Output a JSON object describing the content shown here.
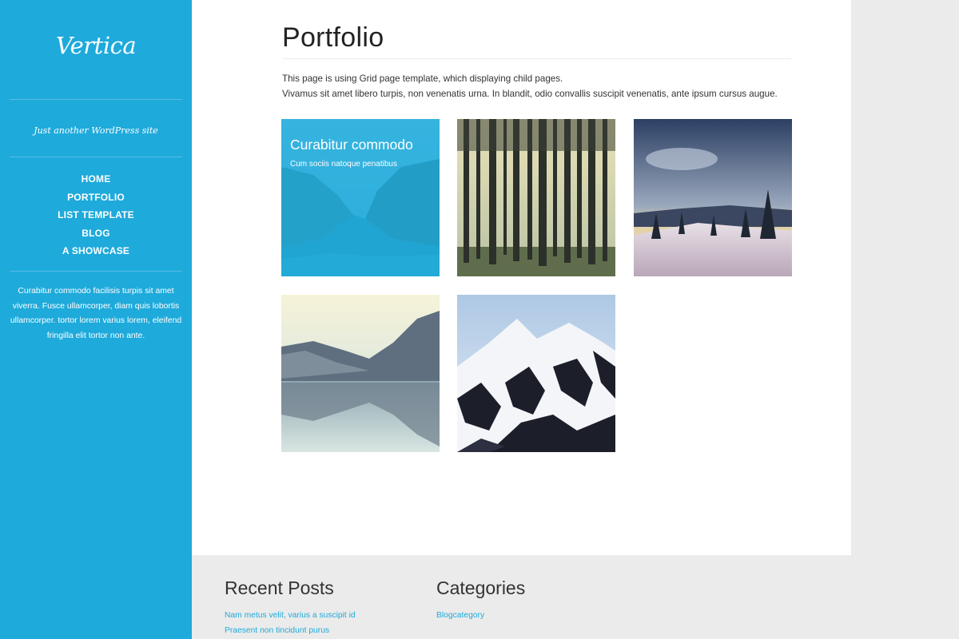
{
  "site": {
    "title": "Vertica",
    "tagline": "Just another WordPress site"
  },
  "nav": {
    "items": [
      "HOME",
      "PORTFOLIO",
      "LIST TEMPLATE",
      "BLOG",
      "A SHOWCASE"
    ]
  },
  "sidebar": {
    "text": "Curabitur commodo facilisis turpis sit amet viverra. Fusce ullamcorper, diam quis lobortis ullamcorper. tortor lorem varius lorem, eleifend fringilla elit tortor non ante."
  },
  "page": {
    "title": "Portfolio",
    "intro_line1": "This page is using Grid page template, which displaying child pages.",
    "intro_line2": "Vivamus sit amet libero turpis, non venenatis urna. In blandit, odio convallis suscipit venenatis, ante ipsum cursus augue."
  },
  "portfolio": {
    "hover_item": {
      "title": "Curabitur commodo",
      "subtitle": "Cum sociis natoque penatibus"
    },
    "images": [
      "fjord-image",
      "forest-image",
      "snowy-field-image",
      "lake-reflection-image",
      "snowy-mountain-image"
    ]
  },
  "footer": {
    "recent_posts": {
      "title": "Recent Posts",
      "items": [
        "Nam metus velit, varius a suscipit id",
        "Praesent non tincidunt purus"
      ]
    },
    "categories": {
      "title": "Categories",
      "items": [
        "Blogcategory"
      ]
    }
  },
  "colors": {
    "accent": "#1eaadb",
    "background": "#ebebeb",
    "content": "#ffffff"
  }
}
